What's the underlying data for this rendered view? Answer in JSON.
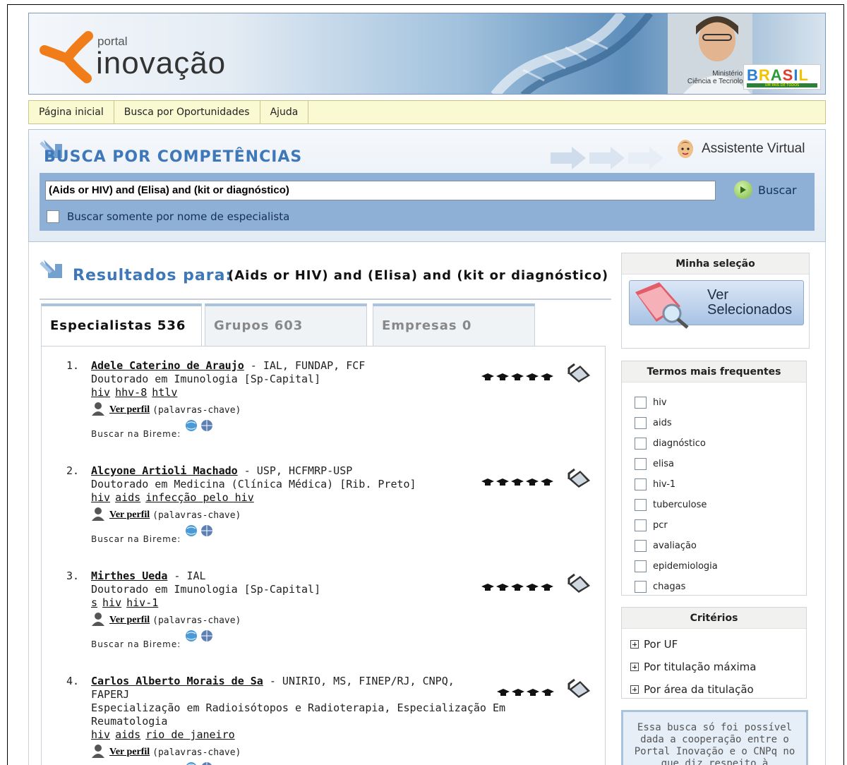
{
  "banner": {
    "logo_small": "portal",
    "logo_big": "inovação",
    "ministry": [
      "Ministério da",
      "Ciência e Tecnologia"
    ],
    "brasil": "BRASIL",
    "brasil_sub": "UM PAÍS DE TODOS"
  },
  "nav": [
    "Página inicial",
    "Busca por Oportunidades",
    "Ajuda"
  ],
  "search": {
    "title": "BUSCA POR COMPETÊNCIAS",
    "assistant_label": "Assistente Virtual",
    "query_value": "(Aids or HIV) and (Elisa) and (kit or diagnóstico)",
    "button_label": "Buscar",
    "only_name_label": "Buscar somente por nome de especialista"
  },
  "results": {
    "title": "Resultados para:",
    "query": "(Aids or HIV) and (Elisa) and (kit or diagnóstico)",
    "tabs": [
      {
        "label": "Especialistas 536",
        "active": true
      },
      {
        "label": "Grupos 603",
        "active": false
      },
      {
        "label": "Empresas 0",
        "active": false
      }
    ],
    "perfil_label": "Ver perfil",
    "perfil_suffix": "(palavras-chave)",
    "bireme_label": "Buscar na Bireme:",
    "items": [
      {
        "num": "1.",
        "name": "Adele Caterino de Araujo",
        "affil": " - IAL, FUNDAP, FCF",
        "lines": [
          "Doutorado em Imunologia [Sp-Capital]"
        ],
        "keywords": [
          "hiv",
          "hhv-8",
          "htlv"
        ],
        "hats": 5
      },
      {
        "num": "2.",
        "name": "Alcyone Artioli Machado",
        "affil": " - USP, HCFMRP-USP",
        "lines": [
          "Doutorado em Medicina (Clínica Médica) [Rib. Preto]"
        ],
        "keywords": [
          "hiv",
          "aids",
          "infecção pelo hiv"
        ],
        "hats": 5
      },
      {
        "num": "3.",
        "name": "Mirthes Ueda",
        "affil": " - IAL",
        "lines": [
          "Doutorado em Imunologia [Sp-Capital]"
        ],
        "keywords": [
          "s",
          "hiv",
          "hiv-1"
        ],
        "hats": 5
      },
      {
        "num": "4.",
        "name": "Carlos Alberto Morais de Sa",
        "affil": " - UNIRIO, MS, FINEP/RJ, CNPQ,",
        "lines": [
          "FAPERJ",
          "Especialização em Radioisótopos e Radioterapia, Especialização Em",
          "Reumatologia"
        ],
        "keywords": [
          "hiv",
          "aids",
          "rio de janeiro"
        ],
        "hats": 4
      }
    ]
  },
  "sidebar": {
    "selection_title": "Minha seleção",
    "ver_line1": "Ver",
    "ver_line2": "Selecionados",
    "terms_title": "Termos mais frequentes",
    "terms": [
      "hiv",
      "aids",
      "diagnóstico",
      "elisa",
      "hiv-1",
      "tuberculose",
      "pcr",
      "avaliação",
      "epidemiologia",
      "chagas"
    ],
    "criteria_title": "Critérios",
    "criteria": [
      "Por UF",
      "Por titulação máxima",
      "Por área da titulação"
    ],
    "coop_text": "Essa busca só foi possível dada a cooperação entre o Portal Inovação e o CNPq no que diz respeito à"
  },
  "colors": {
    "accent_blue": "#3e78b8",
    "nav_bg": "#fafad2",
    "search_band": "#8fb0d6"
  }
}
